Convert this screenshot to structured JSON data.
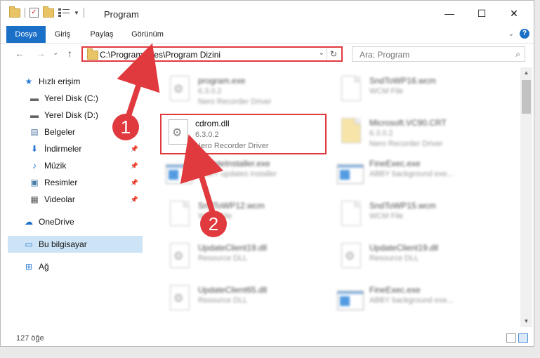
{
  "window": {
    "title": "Program",
    "minimize": "—",
    "maximize": "☐",
    "close": "✕"
  },
  "ribbon": {
    "tabs": [
      "Dosya",
      "Giriş",
      "Paylaş",
      "Görünüm"
    ],
    "expand": "⌄",
    "help": "?"
  },
  "nav": {
    "back": "←",
    "forward": "→",
    "recent": "⌄",
    "up": "↑",
    "address": "C:\\Program Files\\Program Dizini",
    "address_dropdown": "⌄",
    "refresh": "↻",
    "search_placeholder": "Ara: Program",
    "search_icon": "⌕"
  },
  "sidebar": {
    "items": [
      {
        "label": "Hızlı erişim",
        "icon": "★"
      },
      {
        "label": "Yerel Disk (C:)",
        "icon": "▬"
      },
      {
        "label": "Yerel Disk (D:)",
        "icon": "▬"
      },
      {
        "label": "Belgeler",
        "icon": "▤"
      },
      {
        "label": "İndirmeler",
        "icon": "⬇"
      },
      {
        "label": "Müzik",
        "icon": "♪"
      },
      {
        "label": "Resimler",
        "icon": "▣"
      },
      {
        "label": "Videolar",
        "icon": "▦"
      },
      {
        "label": "OneDrive",
        "icon": "☁"
      },
      {
        "label": "Bu bilgisayar",
        "icon": "▭"
      },
      {
        "label": "Ağ",
        "icon": "⊞"
      }
    ],
    "pin": "📌"
  },
  "files": [
    {
      "name": "program.exe",
      "version": "6.3.0.2",
      "desc": "Nero Recorder Driver"
    },
    {
      "name": "SndToWP16.wcm",
      "version": "",
      "desc": "WCM File"
    },
    {
      "name": "cdrom.dll",
      "version": "6.3.0.2",
      "desc": "Nero Recorder Driver"
    },
    {
      "name": "Microsoft.VC90.CRT",
      "version": "6.3.0.2",
      "desc": "Nero Recorder Driver"
    },
    {
      "name": "UpdateInstaller.exe",
      "version": "",
      "desc": "ABBY updates installer"
    },
    {
      "name": "FineExec.exe",
      "version": "",
      "desc": "ABBY background exe..."
    },
    {
      "name": "SndToWP12.wcm",
      "version": "",
      "desc": "WCM File"
    },
    {
      "name": "SndToWP15.wcm",
      "version": "",
      "desc": "WCM File"
    },
    {
      "name": "UpdateClient19.dll",
      "version": "",
      "desc": "Resource DLL"
    },
    {
      "name": "UpdateClient19.dll",
      "version": "",
      "desc": "Resource DLL"
    },
    {
      "name": "UpdateClient65.dll",
      "version": "",
      "desc": "Resource DLL"
    },
    {
      "name": "FineExec.exe",
      "version": "",
      "desc": "ABBY background exe..."
    }
  ],
  "status": {
    "count": "127 öğe"
  },
  "annotations": {
    "marker1": "1",
    "marker2": "2",
    "color": "#e0393e"
  }
}
